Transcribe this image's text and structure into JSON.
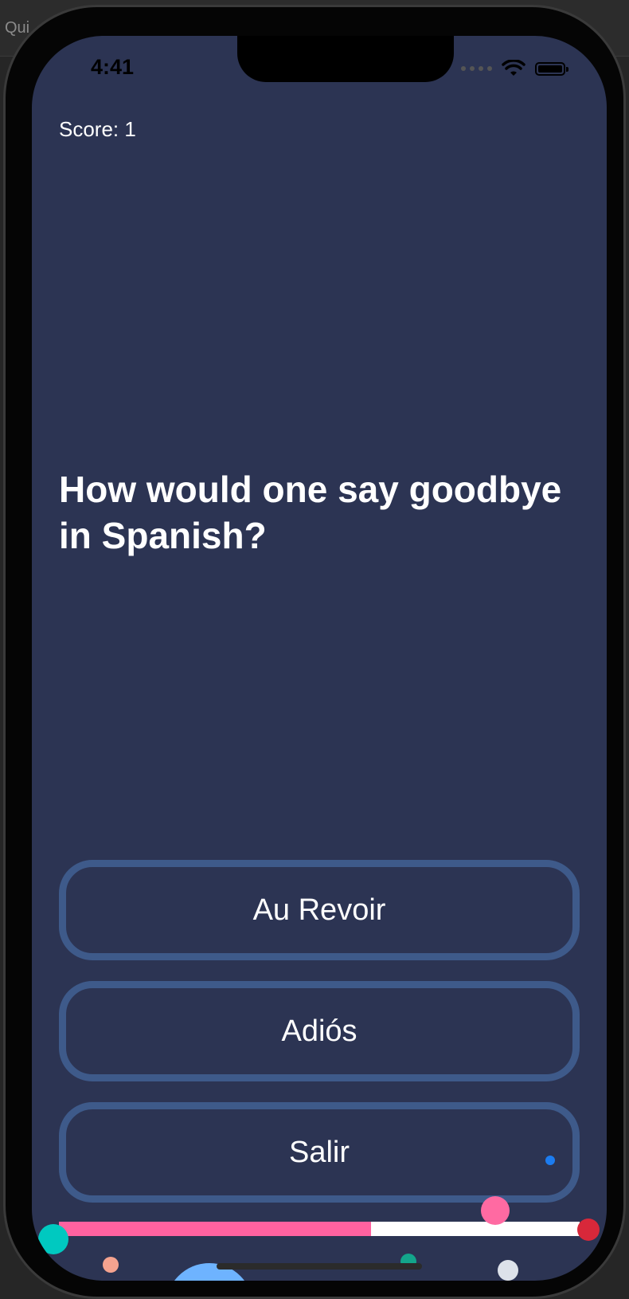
{
  "backdrop": {
    "title": "Qui"
  },
  "status_bar": {
    "time": "4:41"
  },
  "quiz": {
    "score_label": "Score: 1",
    "question": "How would one say goodbye in Spanish?",
    "answers": [
      "Au Revoir",
      "Adiós",
      "Salir"
    ],
    "progress": 0.6
  },
  "colors": {
    "screen_bg": "#2c3453",
    "answer_border": "#3e5a8a",
    "progress_fill": "#ff62a0",
    "progress_track": "#ffffff"
  },
  "icons": {
    "signal": "signal-icon",
    "wifi": "wifi-icon",
    "battery": "battery-icon"
  }
}
